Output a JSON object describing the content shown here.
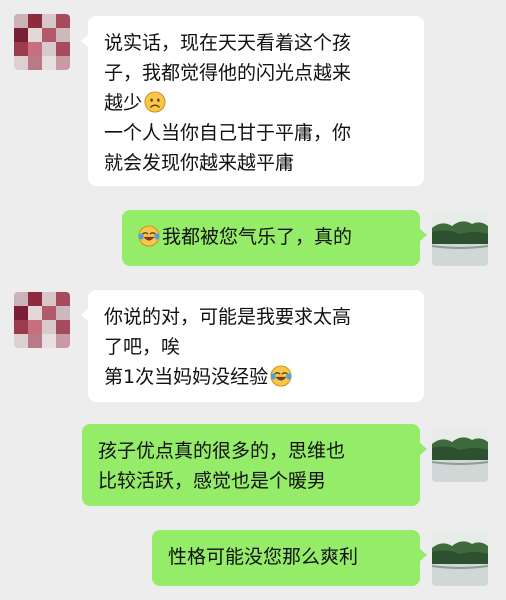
{
  "messages": [
    {
      "side": "left",
      "lines": [
        "说实话，现在天天看着这个孩",
        "子，我都觉得他的闪光点越来",
        "越少",
        "一个人当你自己甘于平庸，你",
        "就会发现你越来越平庸"
      ],
      "emoji": "sad-face-icon"
    },
    {
      "side": "right",
      "text": "我都被您气乐了，真的",
      "emoji": "tears-of-joy-icon"
    },
    {
      "side": "left",
      "lines": [
        "你说的对，可能是我要求太高",
        "了吧，唉",
        "第1次当妈妈没经验"
      ],
      "emoji": "tears-of-joy-icon"
    },
    {
      "side": "right",
      "lines": [
        "孩子优点真的很多的，思维也",
        "比较活跃，感觉也是个暖男"
      ]
    },
    {
      "side": "right",
      "text": "性格可能没您那么爽利"
    }
  ],
  "colors": {
    "background": "#ededed",
    "incoming_bubble": "#ffffff",
    "outgoing_bubble": "#95ec69"
  }
}
